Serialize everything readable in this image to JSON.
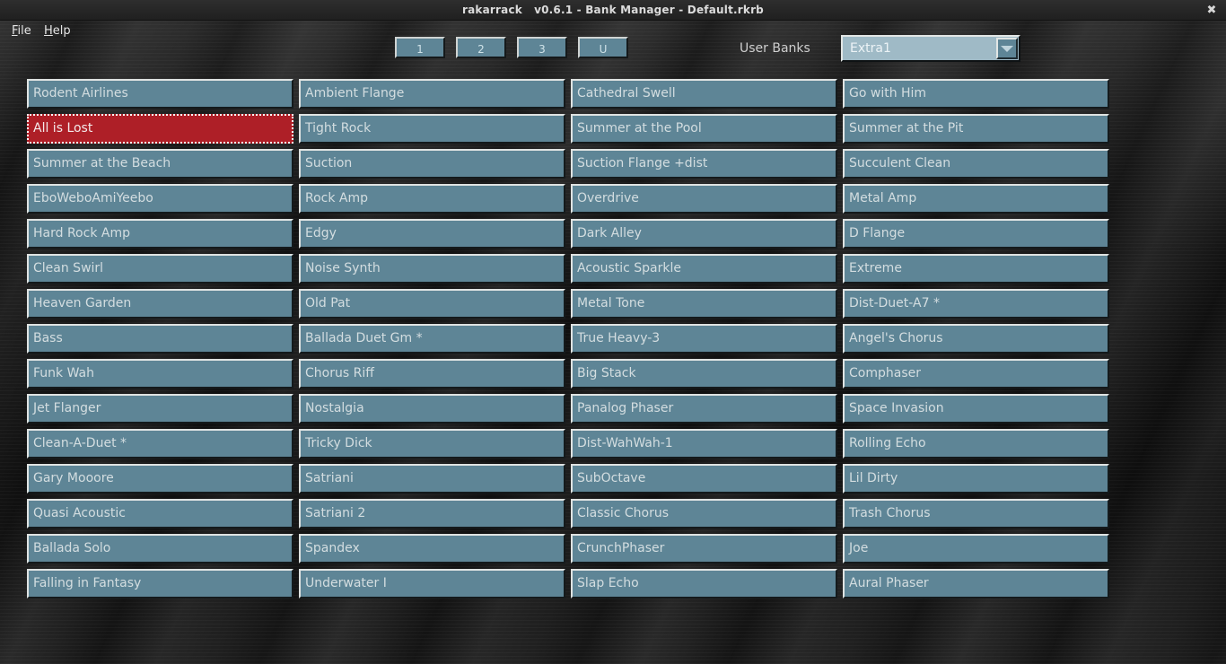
{
  "window": {
    "title": "rakarrack   v0.6.1 - Bank Manager - Default.rkrb",
    "close_label": "✖"
  },
  "menubar": {
    "items": [
      {
        "accel": "F",
        "rest": "ile",
        "name": "file"
      },
      {
        "accel": "H",
        "rest": "elp",
        "name": "help"
      }
    ]
  },
  "toolbar": {
    "bank_buttons": [
      "1",
      "2",
      "3",
      "U"
    ],
    "user_banks_label": "User Banks",
    "user_banks_value": "Extra1",
    "dropdown_icon": "chevron-down-icon"
  },
  "colors": {
    "cell_bg": "#5e8596",
    "cell_selected_bg": "#ae1f27",
    "cell_text": "#d3dde0",
    "select_bg": "#9fbac6",
    "background": "#1a1a1a"
  },
  "preset_grid": {
    "rows": 15,
    "columns": 4,
    "selected": {
      "column": 0,
      "row": 1
    },
    "columns_data": [
      [
        "Rodent Airlines",
        "All is Lost",
        "Summer at the Beach",
        "EboWeboAmiYeebo",
        "Hard Rock Amp",
        "Clean Swirl",
        "Heaven Garden",
        "Bass",
        "Funk Wah",
        "Jet Flanger",
        "Clean-A-Duet *",
        "Gary Mooore",
        "Quasi Acoustic",
        "Ballada Solo",
        "Falling in Fantasy"
      ],
      [
        "Ambient Flange",
        "Tight Rock",
        "Suction",
        "Rock Amp",
        "Edgy",
        "Noise Synth",
        "Old Pat",
        "Ballada Duet Gm *",
        "Chorus Riff",
        "Nostalgia",
        "Tricky Dick",
        "Satriani",
        "Satriani 2",
        "Spandex",
        "Underwater I"
      ],
      [
        "Cathedral Swell",
        "Summer at the Pool",
        "Suction Flange +dist",
        "Overdrive",
        "Dark Alley",
        "Acoustic Sparkle",
        "Metal Tone",
        "True Heavy-3",
        "Big Stack",
        "Panalog Phaser",
        "Dist-WahWah-1",
        "SubOctave",
        "Classic Chorus",
        "CrunchPhaser",
        "Slap Echo"
      ],
      [
        "Go with Him",
        "Summer at the Pit",
        "Succulent Clean",
        "Metal Amp",
        "D Flange",
        "Extreme",
        "Dist-Duet-A7 *",
        "Angel's Chorus",
        "Comphaser",
        "Space Invasion",
        "Rolling Echo",
        "Lil Dirty",
        "Trash Chorus",
        "Joe",
        "Aural Phaser"
      ]
    ]
  }
}
